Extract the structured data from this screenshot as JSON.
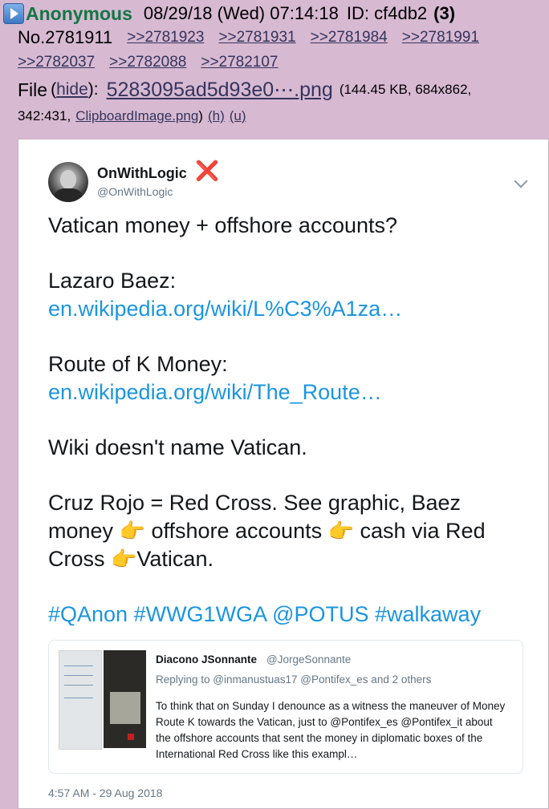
{
  "post": {
    "name": "Anonymous",
    "date": "08/29/18 (Wed) 07:14:18",
    "id_label": "ID: cf4db2",
    "id_count": "(3)",
    "number": "No.2781911",
    "replies": [
      ">>2781923",
      ">>2781931",
      ">>2781984",
      ">>2781991",
      ">>2782037",
      ">>2782088",
      ">>2782107"
    ],
    "file": {
      "label": "File",
      "hide_open": "(",
      "hide": "hide",
      "hide_close": "):",
      "filename": "5283095ad5d93e0⋯.png",
      "meta": "(144.45 KB, 684x862,",
      "thumb_dims": "342:431,",
      "original_name": "ClipboardImage.png",
      "close_paren": ")",
      "h_link": "(h)",
      "u_link": "(u)"
    }
  },
  "tweet": {
    "display_name": "OnWithLogic",
    "badge": "❌",
    "handle": "@OnWithLogic",
    "line1": "Vatican money + offshore accounts?",
    "label_baez": "Lazaro Baez:",
    "link_baez": "en.wikipedia.org/wiki/L%C3%A1za…",
    "label_route": "Route of K Money:",
    "link_route": "en.wikipedia.org/wiki/The_Route…",
    "line_wiki": "Wiki doesn't name Vatican.",
    "cruz_a": "Cruz Rojo = Red Cross. See graphic, Baez money",
    "cruz_b": "offshore accounts",
    "cruz_c": "cash via Red Cross",
    "cruz_d": "Vatican.",
    "pointing_emoji": "👉",
    "hashtags": "#QAnon #WWG1WGA @POTUS #walkaway",
    "timestamp": "4:57 AM - 29 Aug 2018",
    "quoted": {
      "name": "Diacono JSonnante",
      "handle": "@JorgeSonnante",
      "reply": "Replying to @inmanustuas17 @Pontifex_es and 2 others",
      "text": "To think that on Sunday I denounce as a witness the maneuver of Money Route K towards the Vatican, just to @Pontifex_es @Pontifex_it about the offshore accounts that sent the money in diplomatic boxes of the International Red Cross like this exampl…"
    }
  },
  "colors": {
    "page_bg": "#d7b9d2",
    "name_green": "#117743",
    "link": "#34345c",
    "tweet_link": "#1b95e0"
  }
}
